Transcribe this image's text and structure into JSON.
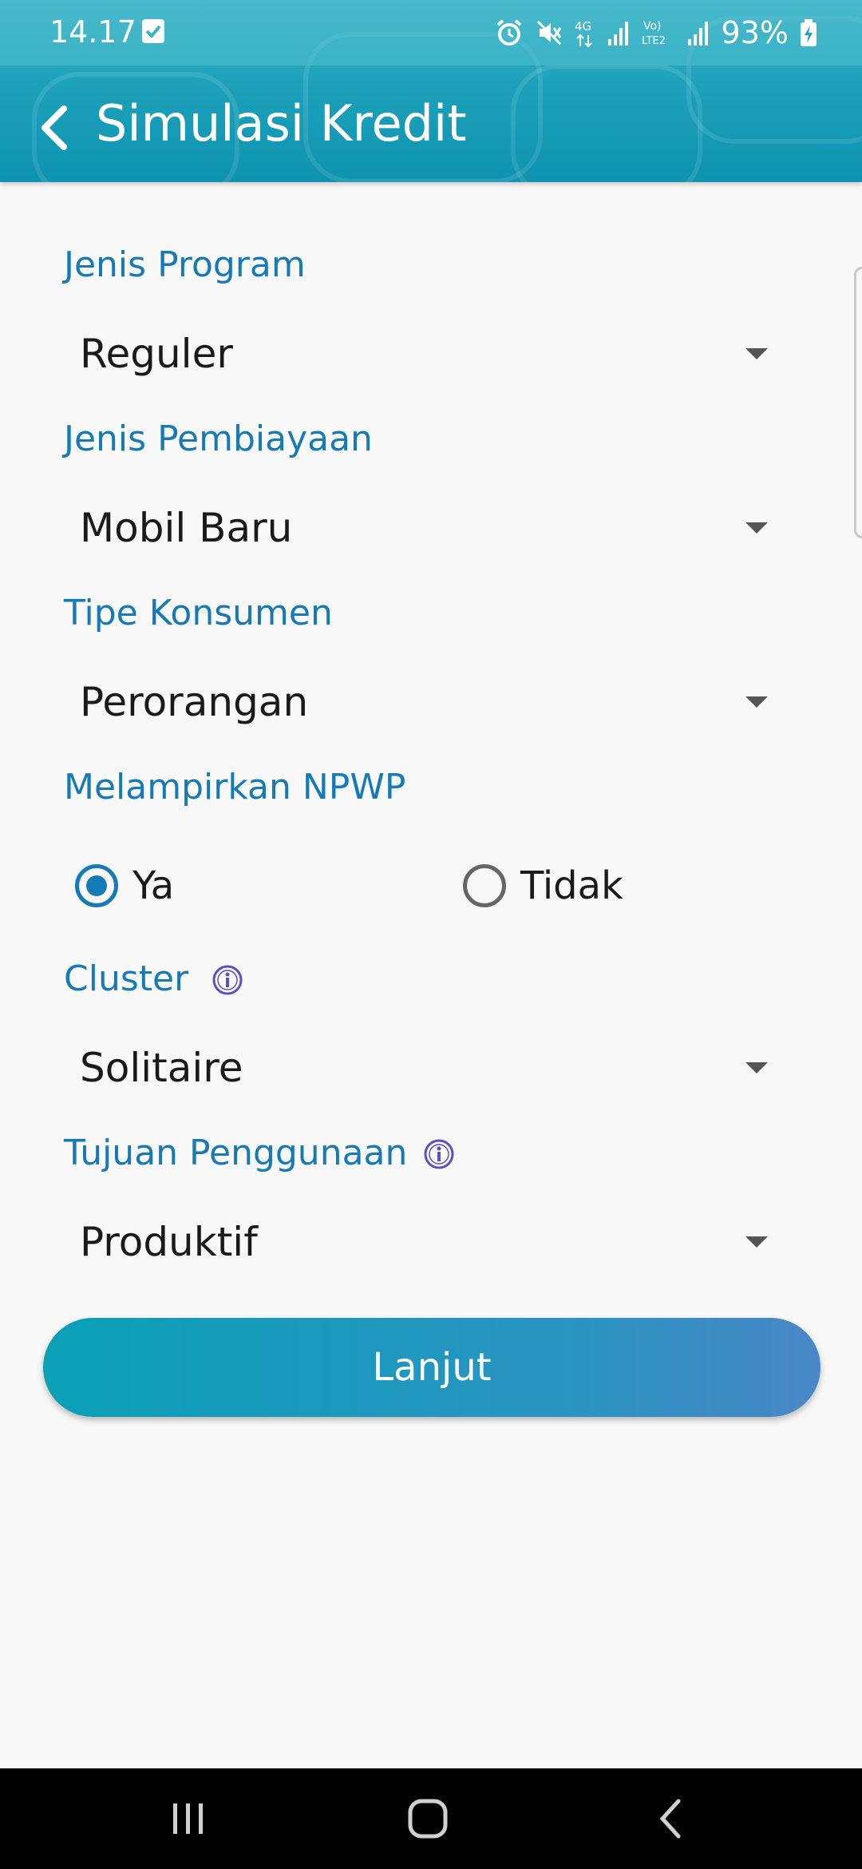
{
  "status_bar": {
    "time": "14.17",
    "battery": "93%",
    "icons": [
      "check-notification-icon",
      "alarm-icon",
      "mute-icon",
      "4g-icon",
      "signal-icon",
      "volte-icon",
      "signal-icon",
      "battery-charging-icon"
    ]
  },
  "app_bar": {
    "title": "Simulasi Kredit",
    "back_icon": "chevron-left-icon"
  },
  "form": {
    "jenis_program": {
      "label": "Jenis Program",
      "value": "Reguler"
    },
    "jenis_pembiayaan": {
      "label": "Jenis Pembiayaan",
      "value": "Mobil Baru"
    },
    "tipe_konsumen": {
      "label": "Tipe Konsumen",
      "value": "Perorangan"
    },
    "npwp": {
      "label": "Melampirkan NPWP",
      "options": [
        {
          "label": "Ya",
          "selected": true
        },
        {
          "label": "Tidak",
          "selected": false
        }
      ]
    },
    "cluster": {
      "label": "Cluster",
      "value": "Solitaire"
    },
    "tujuan": {
      "label": "Tujuan Penggunaan",
      "value": "Produktif"
    }
  },
  "next_button": {
    "label": "Lanjut"
  },
  "colors": {
    "accent": "#1679b8",
    "header": "#1ea2bb",
    "info_icon": "#5b4fc8"
  },
  "nav_bar": {
    "icons": [
      "recent-apps-icon",
      "home-icon",
      "back-icon"
    ]
  }
}
